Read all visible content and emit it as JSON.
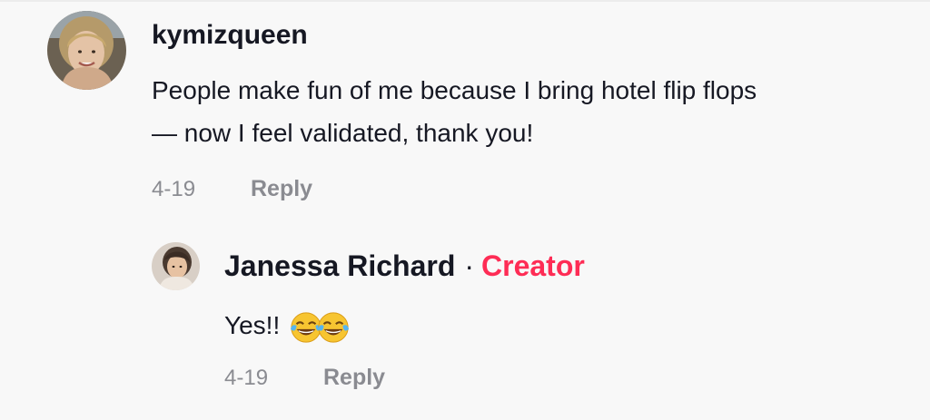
{
  "comment": {
    "username": "kymizqueen",
    "text_line1": "People make fun of me because I bring hotel flip flops",
    "text_line2": "— now I feel validated, thank you!",
    "date": "4-19",
    "reply_label": "Reply",
    "avatar_icon": "user-avatar"
  },
  "reply": {
    "username": "Janessa Richard",
    "separator": "·",
    "badge": "Creator",
    "text": "Yes!!",
    "emoji_icons": [
      "tears-of-joy-emoji",
      "tears-of-joy-emoji"
    ],
    "date": "4-19",
    "reply_label": "Reply",
    "avatar_icon": "user-avatar"
  },
  "colors": {
    "background": "#f8f8f8",
    "creator_badge": "#fe2c55",
    "meta": "#8a8b91",
    "text": "#161823"
  }
}
